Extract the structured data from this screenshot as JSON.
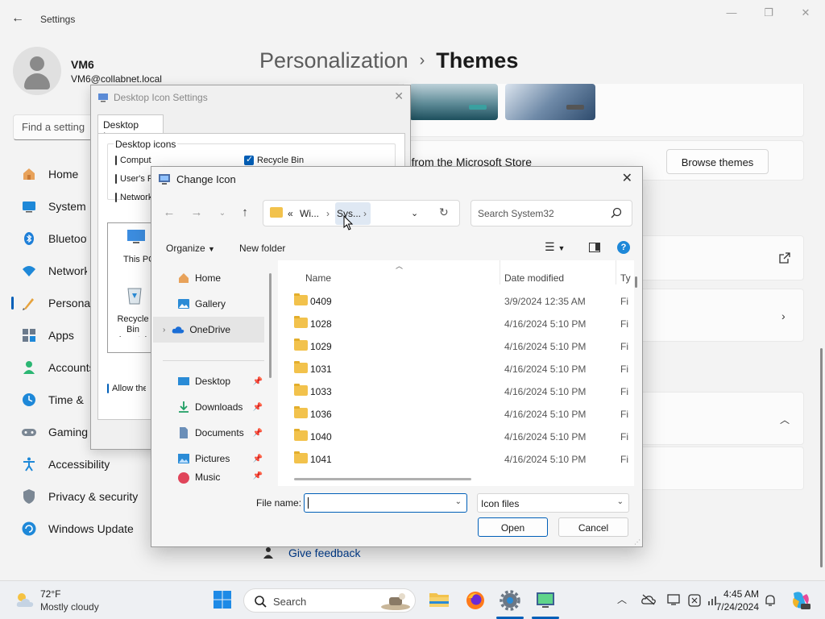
{
  "settings": {
    "app_title": "Settings",
    "user": {
      "name": "VM6",
      "email": "VM6@collabnet.local"
    },
    "find_placeholder": "Find a setting",
    "nav": [
      {
        "label": "Home",
        "icon": "home-icon"
      },
      {
        "label": "System",
        "icon": "system-icon"
      },
      {
        "label": "Bluetooth & devices",
        "icon": "bluetooth-icon"
      },
      {
        "label": "Network & internet",
        "icon": "network-icon"
      },
      {
        "label": "Personalization",
        "icon": "personalization-icon"
      },
      {
        "label": "Apps",
        "icon": "apps-icon"
      },
      {
        "label": "Accounts",
        "icon": "accounts-icon"
      },
      {
        "label": "Time & language",
        "icon": "time-icon"
      },
      {
        "label": "Gaming",
        "icon": "gaming-icon"
      },
      {
        "label": "Accessibility",
        "icon": "accessibility-icon"
      },
      {
        "label": "Privacy & security",
        "icon": "privacy-icon"
      },
      {
        "label": "Windows Update",
        "icon": "update-icon"
      }
    ],
    "breadcrumb": {
      "parent": "Personalization",
      "separator": "›",
      "current": "Themes"
    },
    "store_text": "Get more themes from the Microsoft Store",
    "browse_button": "Browse themes",
    "give_feedback": "Give feedback"
  },
  "desktop_icon_settings": {
    "title": "Desktop Icon Settings",
    "tab": "Desktop Icons",
    "group_label": "Desktop icons",
    "checkboxes": [
      {
        "label": "Computer",
        "checked": false
      },
      {
        "label": "User's Files",
        "checked": false
      },
      {
        "label": "Network",
        "checked": false
      },
      {
        "label": "Recycle Bin",
        "checked": true
      }
    ],
    "icons": [
      "This PC",
      "Recycle Bin (empty)"
    ],
    "allow_themes": "Allow themes to change desktop icons"
  },
  "change_icon": {
    "title": "Change Icon",
    "address": {
      "prefix": "«",
      "segments": [
        "Wi...",
        "Sys..."
      ]
    },
    "search_placeholder": "Search System32",
    "toolbar": {
      "organize": "Organize",
      "new_folder": "New folder"
    },
    "nav_pane": [
      {
        "label": "Home",
        "icon": "home-icon",
        "pinned": false
      },
      {
        "label": "Gallery",
        "icon": "gallery-icon",
        "pinned": false
      },
      {
        "label": "OneDrive",
        "icon": "onedrive-icon",
        "pinned": false,
        "selected": true
      },
      {
        "label": "Desktop",
        "icon": "desktop-icon",
        "pinned": true
      },
      {
        "label": "Downloads",
        "icon": "downloads-icon",
        "pinned": true
      },
      {
        "label": "Documents",
        "icon": "documents-icon",
        "pinned": true
      },
      {
        "label": "Pictures",
        "icon": "pictures-icon",
        "pinned": true
      },
      {
        "label": "Music",
        "icon": "music-icon",
        "pinned": true
      }
    ],
    "columns": {
      "name": "Name",
      "date": "Date modified",
      "type": "Ty"
    },
    "files": [
      {
        "name": "0409",
        "date": "3/9/2024 12:35 AM",
        "type": "Fi"
      },
      {
        "name": "1028",
        "date": "4/16/2024 5:10 PM",
        "type": "Fi"
      },
      {
        "name": "1029",
        "date": "4/16/2024 5:10 PM",
        "type": "Fi"
      },
      {
        "name": "1031",
        "date": "4/16/2024 5:10 PM",
        "type": "Fi"
      },
      {
        "name": "1033",
        "date": "4/16/2024 5:10 PM",
        "type": "Fi"
      },
      {
        "name": "1036",
        "date": "4/16/2024 5:10 PM",
        "type": "Fi"
      },
      {
        "name": "1040",
        "date": "4/16/2024 5:10 PM",
        "type": "Fi"
      },
      {
        "name": "1041",
        "date": "4/16/2024 5:10 PM",
        "type": "Fi"
      }
    ],
    "file_name_label": "File name:",
    "file_name_value": "",
    "file_type": "Icon files",
    "open_button": "Open",
    "cancel_button": "Cancel"
  },
  "taskbar": {
    "weather_temp": "72°F",
    "weather_desc": "Mostly cloudy",
    "search_label": "Search",
    "time": "4:45 AM",
    "date": "7/24/2024"
  },
  "colors": {
    "accent": "#005fb8",
    "folder": "#f2c24c"
  }
}
